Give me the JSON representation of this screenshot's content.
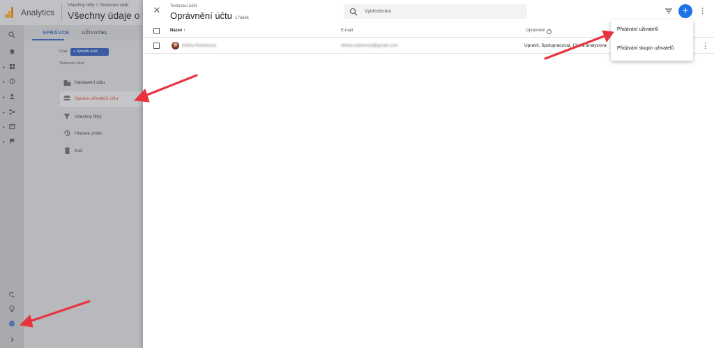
{
  "app": {
    "name": "Analytics",
    "breadcrumb": "Všechny účty > Testovací web",
    "property_name": "Všechny údaje o webu"
  },
  "colors": {
    "accent": "#1a73e8",
    "arrow": "#e8343f",
    "active_menu": "#b84a3c"
  },
  "admin": {
    "tabs": [
      {
        "label": "SPRÁVCE"
      },
      {
        "label": "UŽIVATEL"
      }
    ],
    "account_label": "Účet",
    "create_account": "+ Vytvořit účet",
    "account_name": "Testovací účet",
    "menu": [
      {
        "label": "Nastavení účtu",
        "icon": "building-icon"
      },
      {
        "label": "Správa uživatelů účtu",
        "icon": "people-icon"
      },
      {
        "label": "Všechny filtry",
        "icon": "filter-icon"
      },
      {
        "label": "Historie změn",
        "icon": "history-icon"
      },
      {
        "label": "Koš",
        "icon": "trash-icon"
      }
    ]
  },
  "panel": {
    "subtitle": "Testovací účet",
    "title": "Oprávnění účtu",
    "row_count": "1 řádek",
    "search_placeholder": "Vyhledávání",
    "columns": {
      "name": "Název ↑",
      "email": "E-mail",
      "permissions": "Oprávnění"
    },
    "rows": [
      {
        "name": "Eliška Reinerová",
        "email": "eliska.reinerova@gmail.com",
        "permissions": "Upravit, Spolupracovat, Číst a analyzovat"
      }
    ],
    "add_menu": [
      "Přidávání uživatelů",
      "Přidávání skupin uživatelů"
    ]
  }
}
